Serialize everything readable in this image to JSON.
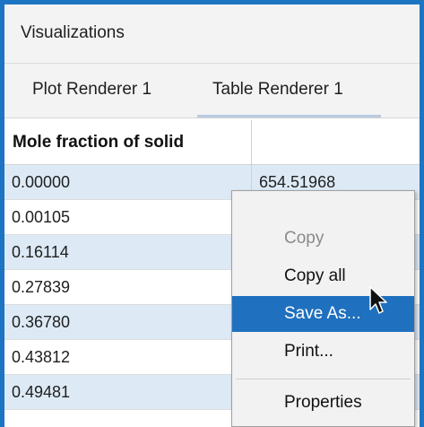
{
  "panel": {
    "title": "Visualizations"
  },
  "tabs": [
    {
      "label": "Plot Renderer 1",
      "active": false
    },
    {
      "label": "Table Renderer 1",
      "active": true
    }
  ],
  "table": {
    "columns": [
      "Mole fraction of solid",
      ""
    ],
    "rows": [
      [
        "0.00000",
        "654.51968"
      ],
      [
        "0.00105",
        ""
      ],
      [
        "0.16114",
        ""
      ],
      [
        "0.27839",
        ""
      ],
      [
        "0.36780",
        ""
      ],
      [
        "0.43812",
        ""
      ],
      [
        "0.49481",
        ""
      ]
    ]
  },
  "context_menu": {
    "items": [
      {
        "label": "Copy",
        "enabled": false
      },
      {
        "label": "Copy all",
        "enabled": true
      },
      {
        "label": "Save As...",
        "enabled": true,
        "highlighted": true
      },
      {
        "label": "Print...",
        "enabled": true
      },
      {
        "label": "Properties",
        "enabled": true
      }
    ]
  },
  "colors": {
    "accent": "#1c74c2",
    "row_alt": "#ddeaf6",
    "menu_highlight": "#1f70bf"
  }
}
